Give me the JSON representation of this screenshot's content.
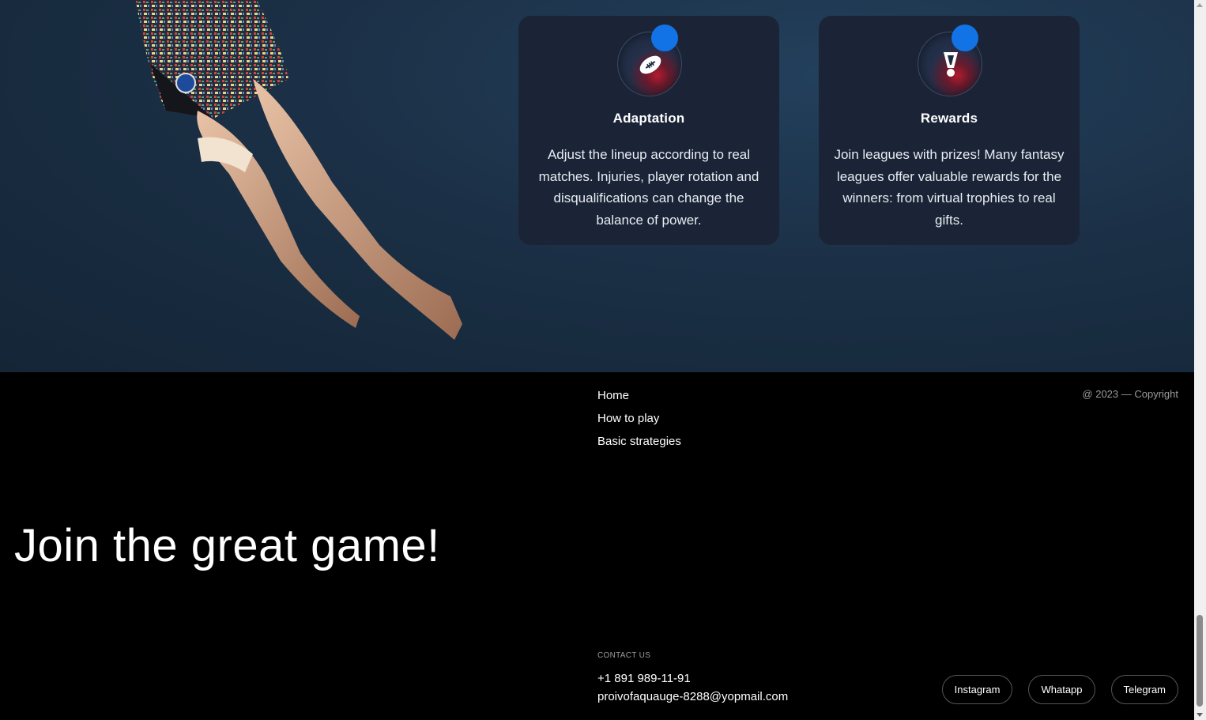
{
  "features": {
    "cards": [
      {
        "title": "Adaptation",
        "text": "Adjust the lineup according to real matches. Injuries, player rotation and disqualifications can change the balance of power.",
        "icon": "football-icon"
      },
      {
        "title": "Rewards",
        "text": "Join leagues with prizes! Many fantasy leagues offer valuable rewards for the winners: from virtual trophies to real gifts.",
        "icon": "medal-icon"
      }
    ]
  },
  "footer": {
    "nav": [
      "Home",
      "How to play",
      "Basic strategies"
    ],
    "copyright": "@ 2023 — Copyright",
    "headline": "Join the great game!",
    "contact_label": "CONTACT US",
    "phone": "+1 891 989-11-91",
    "email": "proivofaquauge-8288@yopmail.com",
    "socials": [
      "Instagram",
      "Whatapp",
      "Telegram"
    ]
  },
  "colors": {
    "accent_blue": "#1273e6",
    "accent_red": "#b01c2e",
    "card_bg": "#1a2436"
  }
}
